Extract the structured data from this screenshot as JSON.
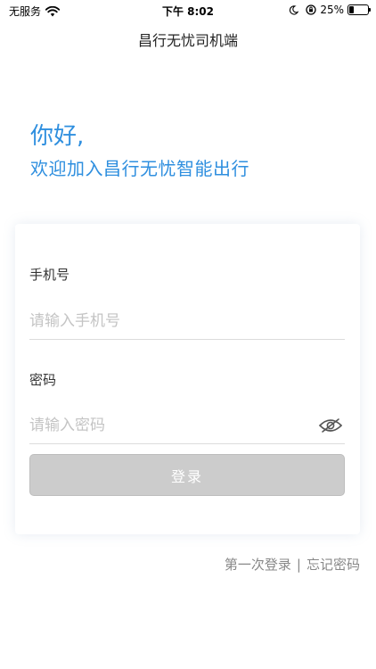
{
  "status_bar": {
    "carrier": "无服务",
    "time": "下午 8:02",
    "battery_percent": "25%",
    "battery_level": 0.25,
    "icons": [
      "wifi-icon",
      "moon-icon",
      "lock-rotation-icon",
      "battery-icon"
    ]
  },
  "nav": {
    "title": "昌行无忧司机端"
  },
  "greeting": {
    "hello": "你好,",
    "welcome": "欢迎加入昌行无忧智能出行"
  },
  "form": {
    "phone_label": "手机号",
    "phone_placeholder": "请输入手机号",
    "phone_value": "",
    "password_label": "密码",
    "password_placeholder": "请输入密码",
    "password_value": "",
    "login_label": "登录"
  },
  "links": {
    "first_login": "第一次登录",
    "divider": "|",
    "forgot_password": "忘记密码"
  },
  "colors": {
    "accent": "#2f8fdf",
    "button_disabled": "#cccccc",
    "link": "#888888"
  }
}
